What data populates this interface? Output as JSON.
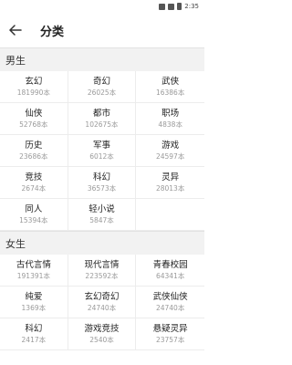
{
  "status": {
    "time": "2:35"
  },
  "header": {
    "title": "分类"
  },
  "sections": [
    {
      "title": "男生",
      "items": [
        {
          "name": "玄幻",
          "count": "181990本"
        },
        {
          "name": "奇幻",
          "count": "26025本"
        },
        {
          "name": "武侠",
          "count": "16386本"
        },
        {
          "name": "仙侠",
          "count": "52768本"
        },
        {
          "name": "都市",
          "count": "102675本"
        },
        {
          "name": "职场",
          "count": "4838本"
        },
        {
          "name": "历史",
          "count": "23686本"
        },
        {
          "name": "军事",
          "count": "6012本"
        },
        {
          "name": "游戏",
          "count": "24597本"
        },
        {
          "name": "竞技",
          "count": "2674本"
        },
        {
          "name": "科幻",
          "count": "36573本"
        },
        {
          "name": "灵异",
          "count": "28013本"
        },
        {
          "name": "同人",
          "count": "15394本"
        },
        {
          "name": "轻小说",
          "count": "5847本"
        }
      ]
    },
    {
      "title": "女生",
      "items": [
        {
          "name": "古代言情",
          "count": "191391本"
        },
        {
          "name": "现代言情",
          "count": "223592本"
        },
        {
          "name": "青春校园",
          "count": "64341本"
        },
        {
          "name": "纯爱",
          "count": "1369本"
        },
        {
          "name": "玄幻奇幻",
          "count": "24740本"
        },
        {
          "name": "武侠仙侠",
          "count": "24740本"
        },
        {
          "name": "科幻",
          "count": "2417本"
        },
        {
          "name": "游戏竞技",
          "count": "2540本"
        },
        {
          "name": "悬疑灵异",
          "count": "23757本"
        }
      ]
    }
  ]
}
